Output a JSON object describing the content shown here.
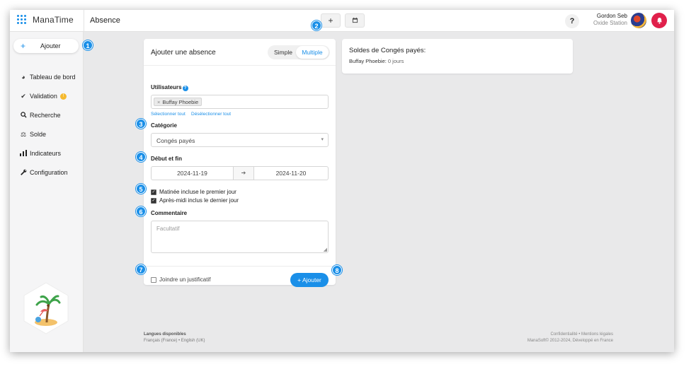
{
  "app": {
    "brand": "ManaTime",
    "page_title": "Absence"
  },
  "topbar": {
    "add_icon": "plus-icon",
    "calendar_icon": "calendar-icon",
    "help_label": "?",
    "user_name": "Gordon Seb",
    "user_org": "Oxide Station"
  },
  "sidebar": {
    "add_label": "Ajouter",
    "items": [
      {
        "label": "Tableau de bord",
        "icon": "pie-chart-icon"
      },
      {
        "label": "Validation",
        "icon": "check-icon",
        "badge": "!"
      },
      {
        "label": "Recherche",
        "icon": "search-icon"
      },
      {
        "label": "Solde",
        "icon": "scale-icon"
      },
      {
        "label": "Indicateurs",
        "icon": "bar-chart-icon"
      },
      {
        "label": "Configuration",
        "icon": "wrench-icon"
      }
    ]
  },
  "form": {
    "title": "Ajouter une absence",
    "mode_simple": "Simple",
    "mode_multiple": "Multiple",
    "users_label": "Utilisateurs",
    "user_chip": "Buffay Phoebie",
    "select_all": "Sélectionner tout",
    "deselect_all": "Désélectionner tout",
    "category_label": "Catégorie",
    "category_value": "Congés payés",
    "dates_label": "Début et fin",
    "start_date": "2024-11-19",
    "end_date": "2024-11-20",
    "morning_label": "Matinée incluse le premier jour",
    "afternoon_label": "Après-midi inclus le dernier jour",
    "comment_label": "Commentaire",
    "comment_placeholder": "Facultatif",
    "attach_label": "Joindre un justificatif",
    "submit_label": "Ajouter"
  },
  "balance": {
    "title": "Soldes de Congés payés:",
    "person": "Buffay Phoebie:",
    "value": "0 jours"
  },
  "markers": [
    "1",
    "2",
    "3",
    "4",
    "5",
    "6",
    "7",
    "8"
  ],
  "footer": {
    "languages_title": "Langues disponibles",
    "languages": "Français (France) • English (UK)",
    "legal": "Confidentialité • Mentions légales",
    "copyright": "ManaSoft© 2012-2024, Développé en France"
  },
  "colors": {
    "accent": "#1a8fe8",
    "notification": "#e0204b",
    "badge": "#f5b92e"
  }
}
